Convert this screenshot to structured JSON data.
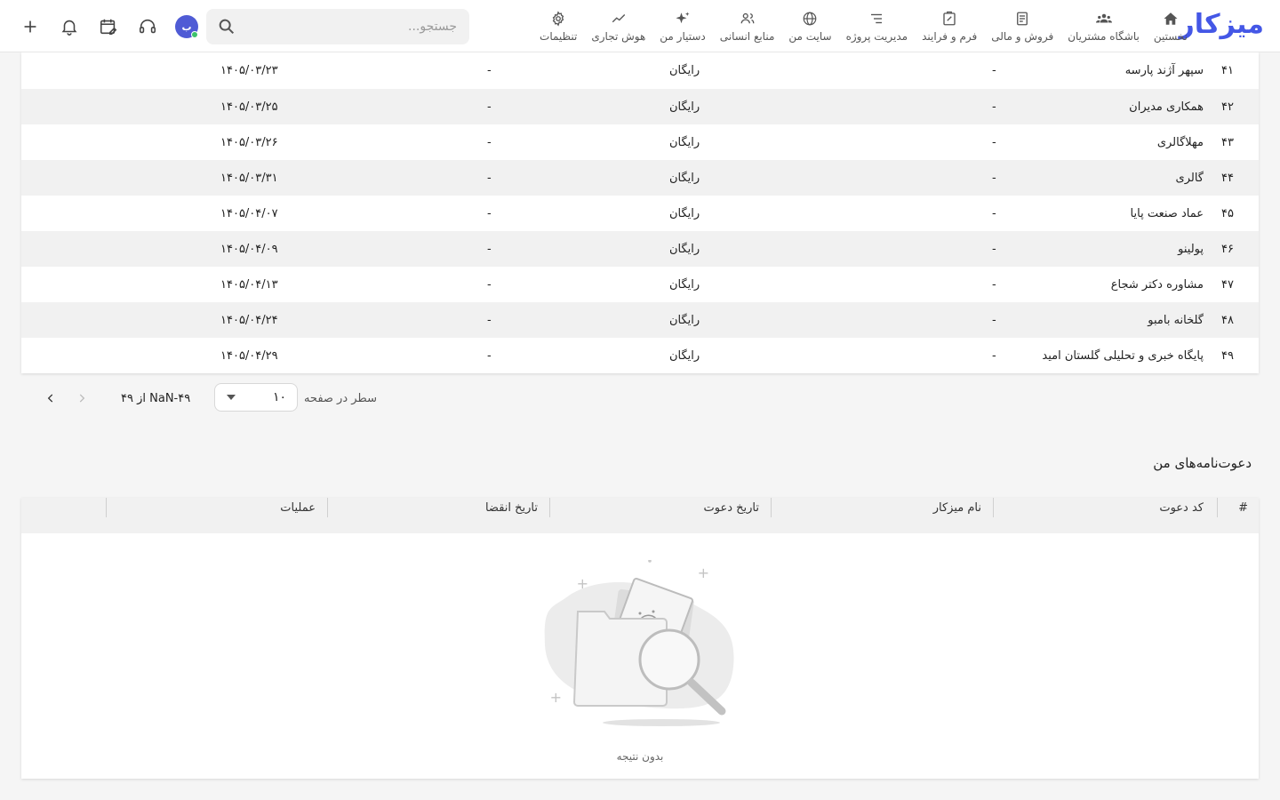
{
  "brand": {
    "logo_text": "میزکار",
    "accent": "#4457e6"
  },
  "nav": [
    {
      "label": "نخستین",
      "icon": "home-icon"
    },
    {
      "label": "باشگاه مشتریان",
      "icon": "users-icon"
    },
    {
      "label": "فروش و مالی",
      "icon": "receipt-icon"
    },
    {
      "label": "فرم و فرایند",
      "icon": "form-icon"
    },
    {
      "label": "مدیریت پروژه",
      "icon": "list-icon"
    },
    {
      "label": "سایت من",
      "icon": "globe-icon"
    },
    {
      "label": "منابع انسانی",
      "icon": "people-icon"
    },
    {
      "label": "دستیار من",
      "icon": "sparkle-icon"
    },
    {
      "label": "هوش تجاری",
      "icon": "trend-icon"
    },
    {
      "label": "تنظیمات",
      "icon": "gear-icon"
    }
  ],
  "search": {
    "placeholder": "جستجو..."
  },
  "avatar": {
    "initials": "ب"
  },
  "table": {
    "rows": [
      {
        "idx": "۴۱",
        "name": "سپهر آژند پارسه",
        "c1": "-",
        "plan": "رایگان",
        "c2": "-",
        "date": "۱۴۰۵/۰۳/۲۳"
      },
      {
        "idx": "۴۲",
        "name": "همکاری مدیران",
        "c1": "-",
        "plan": "رایگان",
        "c2": "-",
        "date": "۱۴۰۵/۰۳/۲۵"
      },
      {
        "idx": "۴۳",
        "name": "مهلاگالری",
        "c1": "-",
        "plan": "رایگان",
        "c2": "-",
        "date": "۱۴۰۵/۰۳/۲۶"
      },
      {
        "idx": "۴۴",
        "name": "گالری",
        "c1": "-",
        "plan": "رایگان",
        "c2": "-",
        "date": "۱۴۰۵/۰۳/۳۱"
      },
      {
        "idx": "۴۵",
        "name": "عماد صنعت پایا",
        "c1": "-",
        "plan": "رایگان",
        "c2": "-",
        "date": "۱۴۰۵/۰۴/۰۷"
      },
      {
        "idx": "۴۶",
        "name": "پولینو",
        "c1": "-",
        "plan": "رایگان",
        "c2": "-",
        "date": "۱۴۰۵/۰۴/۰۹"
      },
      {
        "idx": "۴۷",
        "name": "مشاوره دکتر شجاع",
        "c1": "-",
        "plan": "رایگان",
        "c2": "-",
        "date": "۱۴۰۵/۰۴/۱۳"
      },
      {
        "idx": "۴۸",
        "name": "گلخانه بامبو",
        "c1": "-",
        "plan": "رایگان",
        "c2": "-",
        "date": "۱۴۰۵/۰۴/۲۴"
      },
      {
        "idx": "۴۹",
        "name": "پایگاه خبری و تحلیلی گلستان امید",
        "c1": "-",
        "plan": "رایگان",
        "c2": "-",
        "date": "۱۴۰۵/۰۴/۲۹"
      }
    ]
  },
  "pager": {
    "rows_label": "سطر در صفحه",
    "rows_value": "۱۰",
    "range": "NaN-۴۹ از ۴۹"
  },
  "invites": {
    "title": "دعوت‌نامه‌های من",
    "headers": [
      "#",
      "کد دعوت",
      "نام میزکار",
      "تاریخ دعوت",
      "تاریخ انقضا",
      "عملیات"
    ],
    "empty_text": "بدون نتیجه"
  }
}
